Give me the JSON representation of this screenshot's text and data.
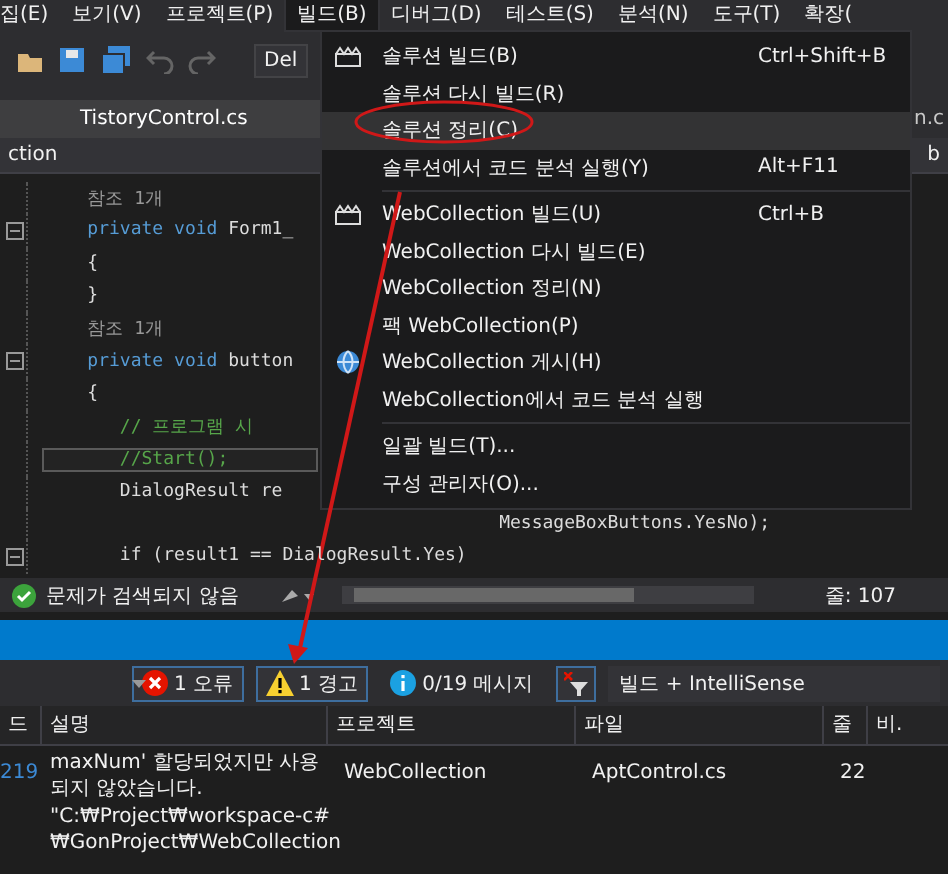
{
  "menubar": [
    {
      "label": "집(E)",
      "selected": false
    },
    {
      "label": "보기(V)",
      "selected": false
    },
    {
      "label": "프로젝트(P)",
      "selected": false
    },
    {
      "label": "빌드(B)",
      "selected": true
    },
    {
      "label": "디버그(D)",
      "selected": false
    },
    {
      "label": "테스트(S)",
      "selected": false
    },
    {
      "label": "분석(N)",
      "selected": false
    },
    {
      "label": "도구(T)",
      "selected": false
    },
    {
      "label": "확장(",
      "selected": false
    }
  ],
  "toolbar": {
    "config": "Del"
  },
  "tabs": [
    {
      "label": "TistoryControl.cs",
      "selected": true
    },
    {
      "label": "n.c",
      "selected": false
    }
  ],
  "navbar": {
    "left": "ction",
    "right": "b"
  },
  "code_lines": [
    {
      "collapsible": false,
      "current": false,
      "tokens": [
        {
          "kind": "ref",
          "text": "    참조 1개"
        }
      ]
    },
    {
      "collapsible": true,
      "current": false,
      "tokens": [
        {
          "kind": "keyword",
          "text": "    private void "
        },
        {
          "kind": "plain",
          "text": "Form1_"
        }
      ]
    },
    {
      "collapsible": false,
      "current": false,
      "tokens": [
        {
          "kind": "plain",
          "text": "    {"
        }
      ]
    },
    {
      "collapsible": false,
      "current": false,
      "tokens": [
        {
          "kind": "plain",
          "text": "    }"
        }
      ]
    },
    {
      "collapsible": false,
      "current": false,
      "tokens": [
        {
          "kind": "ref",
          "text": "    참조 1개"
        }
      ]
    },
    {
      "collapsible": true,
      "current": false,
      "tokens": [
        {
          "kind": "keyword",
          "text": "    private void "
        },
        {
          "kind": "plain",
          "text": "button"
        }
      ]
    },
    {
      "collapsible": false,
      "current": false,
      "tokens": [
        {
          "kind": "plain",
          "text": "    {"
        }
      ]
    },
    {
      "collapsible": false,
      "current": false,
      "tokens": [
        {
          "kind": "comment",
          "text": "       // 프로그램 시"
        }
      ]
    },
    {
      "collapsible": false,
      "current": true,
      "tokens": [
        {
          "kind": "comment",
          "text": "       //Start();"
        }
      ]
    },
    {
      "collapsible": false,
      "current": false,
      "tokens": [
        {
          "kind": "plain",
          "text": "       DialogResult re"
        }
      ]
    },
    {
      "collapsible": false,
      "current": false,
      "tokens": [
        {
          "kind": "plain",
          "text": "                                          MessageBoxButtons.YesNo);"
        }
      ]
    },
    {
      "collapsible": true,
      "current": false,
      "tokens": [
        {
          "kind": "plain",
          "text": "       if (result1 == DialogResult.Yes)"
        }
      ]
    }
  ],
  "menu": [
    {
      "kind": "build",
      "label": "솔루션 빌드(B)",
      "shortcut": "Ctrl+Shift+B",
      "selected": false
    },
    {
      "kind": "item",
      "label": "솔루션 다시 빌드(R)",
      "selected": false
    },
    {
      "kind": "item",
      "label": "솔루션 정리(C)",
      "selected": true
    },
    {
      "kind": "item",
      "label": "솔루션에서 코드 분석 실행(Y)",
      "shortcut": "Alt+F11",
      "selected": false
    },
    {
      "kind": "separator"
    },
    {
      "kind": "build",
      "label": "WebCollection 빌드(U)",
      "shortcut": "Ctrl+B",
      "selected": false
    },
    {
      "kind": "item",
      "label": "WebCollection 다시 빌드(E)",
      "selected": false
    },
    {
      "kind": "item",
      "label": "WebCollection 정리(N)",
      "selected": false
    },
    {
      "kind": "item",
      "label": "팩 WebCollection(P)",
      "selected": false
    },
    {
      "kind": "publish",
      "label": "WebCollection 게시(H)",
      "selected": false
    },
    {
      "kind": "item",
      "label": "WebCollection에서 코드 분석 실행",
      "selected": false
    },
    {
      "kind": "separator"
    },
    {
      "kind": "item",
      "label": "일괄 빌드(T)...",
      "selected": false
    },
    {
      "kind": "item",
      "label": "구성 관리자(O)...",
      "selected": false
    }
  ],
  "status": {
    "message": "문제가 검색되지 않음",
    "line": "줄: 107"
  },
  "error_list": {
    "filters": [
      {
        "kind": "error",
        "label": "1 오류",
        "on": true
      },
      {
        "kind": "warning",
        "label": "1 경고",
        "on": true
      },
      {
        "kind": "info",
        "label": "0/19 메시지",
        "on": false
      }
    ],
    "scope": "빌드 + IntelliSense",
    "columns": [
      "드",
      "설명",
      "프로젝트",
      "파일",
      "줄",
      "비."
    ],
    "rows": [
      {
        "code": "219",
        "description": "maxNum' 할당되었지만 사용 되지 않았습니다.",
        "project": "WebCollection",
        "file": "AptControl.cs",
        "line": "22"
      }
    ],
    "extra_lines": [
      "\"C:₩Project₩workspace-c#",
      "₩GonProject₩WebCollection"
    ]
  }
}
